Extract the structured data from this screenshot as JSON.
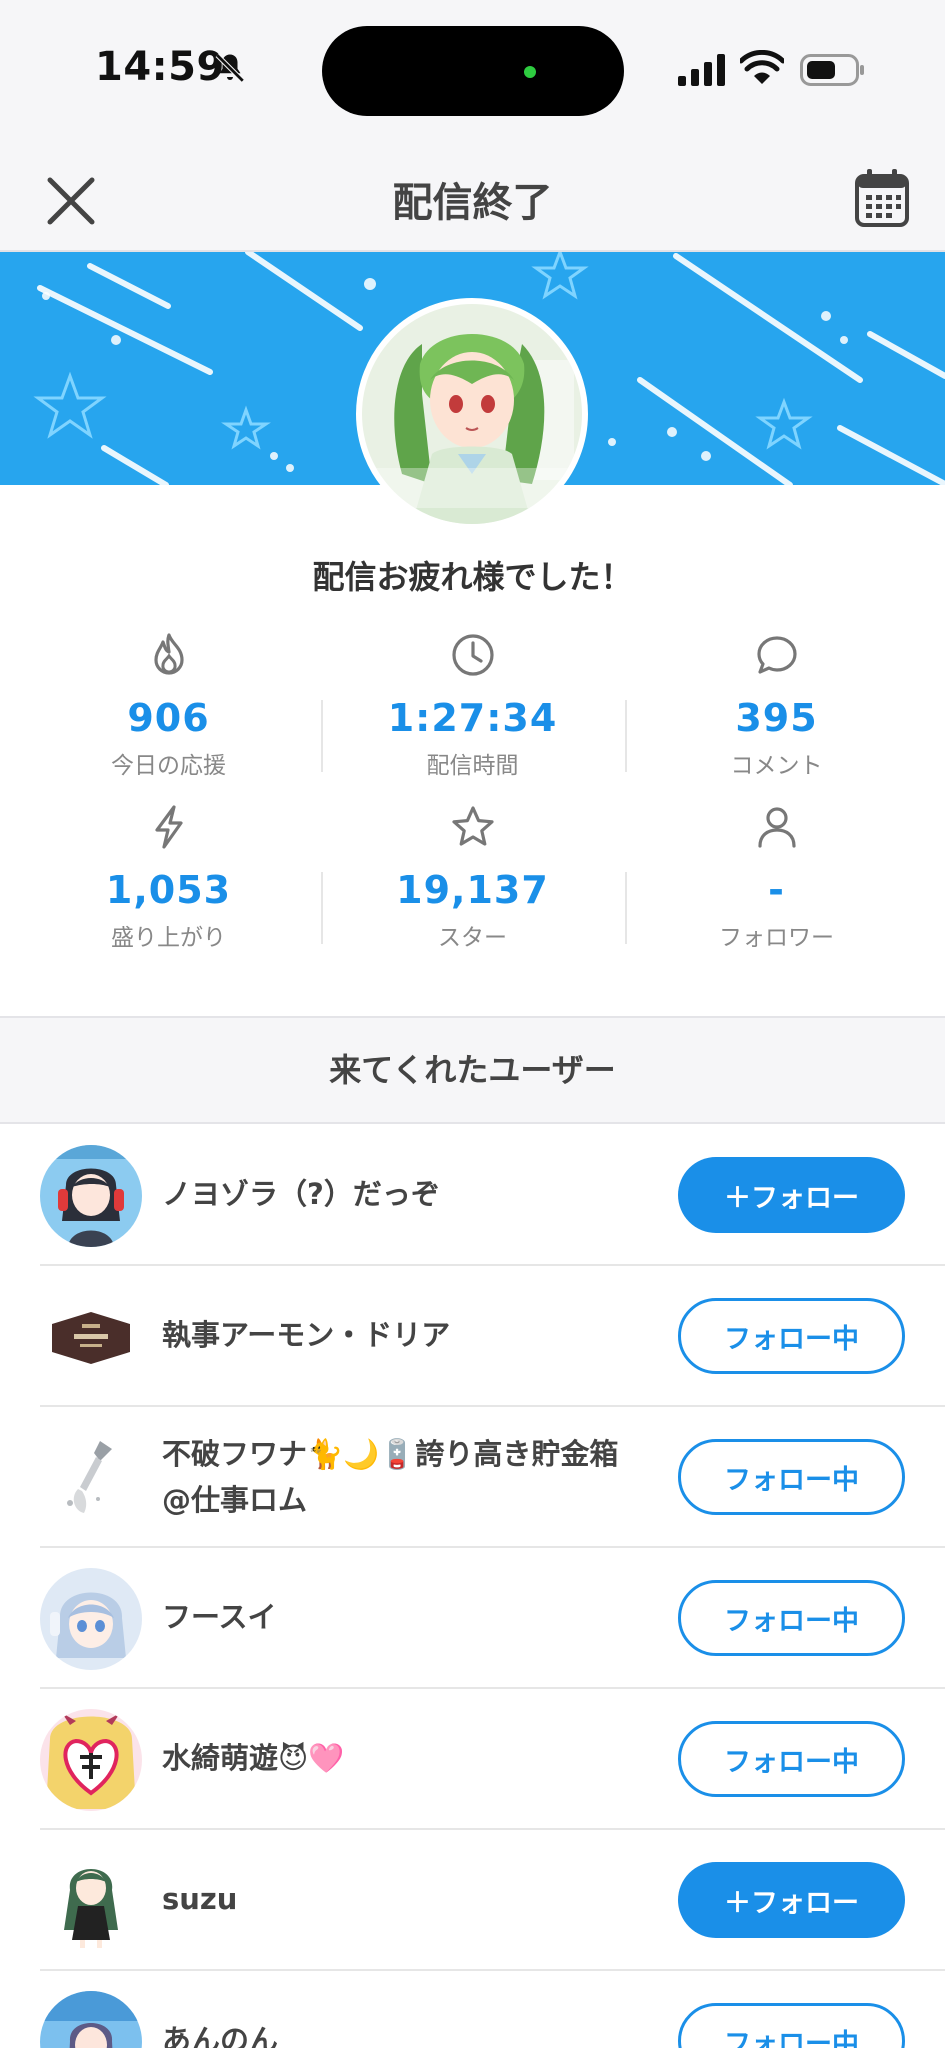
{
  "status_bar": {
    "time": "14:59"
  },
  "nav": {
    "title": "配信終了"
  },
  "summary": {
    "message": "配信お疲れ様でした！",
    "stats": [
      {
        "icon": "flame-icon",
        "value": "906",
        "label": "今日の応援"
      },
      {
        "icon": "clock-icon",
        "value": "1:27:34",
        "label": "配信時間"
      },
      {
        "icon": "comment-icon",
        "value": "395",
        "label": "コメント"
      },
      {
        "icon": "lightning-icon",
        "value": "1,053",
        "label": "盛り上がり"
      },
      {
        "icon": "star-icon",
        "value": "19,137",
        "label": "スター"
      },
      {
        "icon": "person-icon",
        "value": "-",
        "label": "フォロワー"
      }
    ]
  },
  "visitors": {
    "title": "来てくれたユーザー",
    "users": [
      {
        "name": "ノヨゾラ（?）だっぞ",
        "button": "＋フォロー",
        "following": false
      },
      {
        "name": "執事アーモン・ドリア",
        "button": "フォロー中",
        "following": true
      },
      {
        "name": "不破フワナ🐈🌙🪫誇り高き貯金箱@仕事ロム",
        "button": "フォロー中",
        "following": true
      },
      {
        "name": "フースイ",
        "button": "フォロー中",
        "following": true
      },
      {
        "name": "水綺萌遊😈🩷",
        "button": "フォロー中",
        "following": true
      },
      {
        "name": "suzu",
        "button": "＋フォロー",
        "following": false
      },
      {
        "name": "あんのん",
        "button": "フォロー中",
        "following": true
      }
    ]
  },
  "colors": {
    "accent": "#1a8fe8",
    "banner": "#27a5ee"
  }
}
